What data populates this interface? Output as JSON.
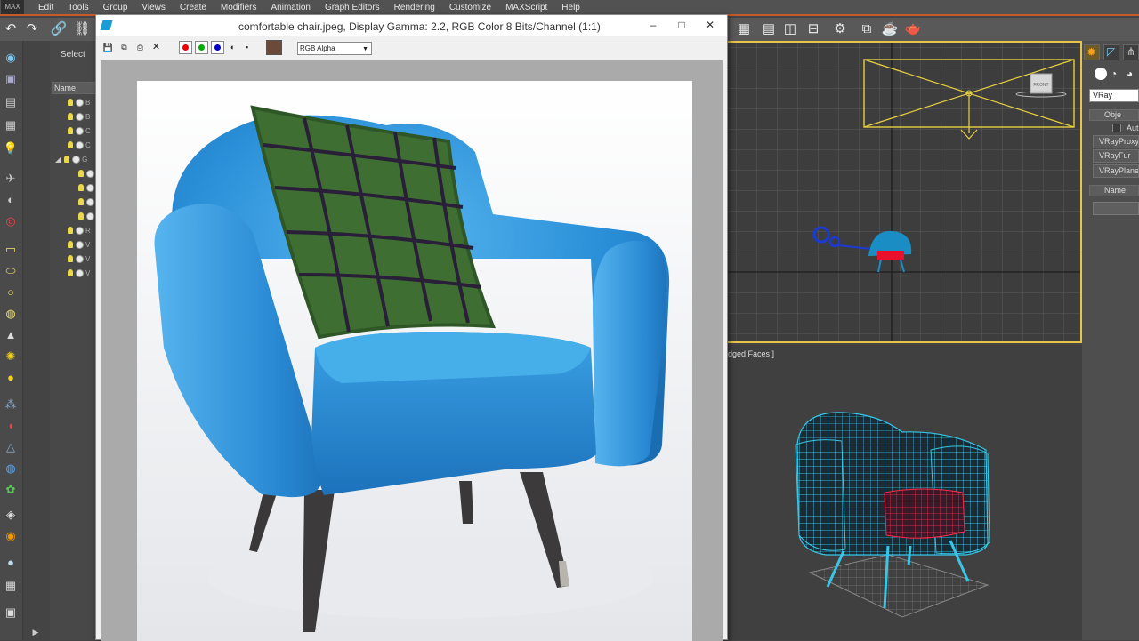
{
  "app": {
    "logo": "MAX"
  },
  "menu": [
    "Edit",
    "Tools",
    "Group",
    "Views",
    "Create",
    "Modifiers",
    "Animation",
    "Graph Editors",
    "Rendering",
    "Customize",
    "MAXScript",
    "Help"
  ],
  "toolbar_icons": [
    "undo-icon",
    "redo-icon",
    "link-icon",
    "unlink-icon",
    "select-by-name-icon",
    "render-setup-icon",
    "render-frame-icon",
    "curve-editor-icon",
    "schematic-icon",
    "material-editor-icon",
    "render-production-icon",
    "render-iterative-icon",
    "teapot-icon"
  ],
  "scene_explorer": {
    "select_label": "Select",
    "column_name": "Name",
    "rows": [
      "B",
      "B",
      "C",
      "C",
      "G",
      "",
      "",
      "",
      "",
      "R",
      "V",
      "V",
      "V"
    ]
  },
  "vfb": {
    "title": "comfortable chair.jpeg, Display Gamma: 2.2, RGB Color 8 Bits/Channel (1:1)",
    "minimize": "–",
    "maximize": "□",
    "close": "✕",
    "channel_display": "RGB Alpha",
    "swatch_color": "#6b4a3a",
    "toolbar_icons": [
      "save-image-icon",
      "clone-frame-icon",
      "print-icon",
      "clear-icon",
      "red-channel-icon",
      "green-channel-icon",
      "blue-channel-icon",
      "alpha-channel-icon",
      "mono-icon"
    ]
  },
  "viewports": {
    "top_label": "",
    "persp_label": "dged Faces ]",
    "gizmo_label": "FRONT",
    "active_border_color": "#e8c44a"
  },
  "command_panel": {
    "dropdown_value": "VRay",
    "object_type_label": "Obje",
    "autogrid_label": "Aut",
    "buttons": [
      "VRayProxy",
      "VRayFur",
      "VRayPlane"
    ],
    "name_section_label": "Name"
  },
  "colors": {
    "accent_orange": "#c85a2a",
    "chair_blue": "#2c8fd8",
    "pillow_green": "#3f6e32",
    "wire_cyan": "#39c6e6",
    "wire_red": "#e0203a"
  }
}
